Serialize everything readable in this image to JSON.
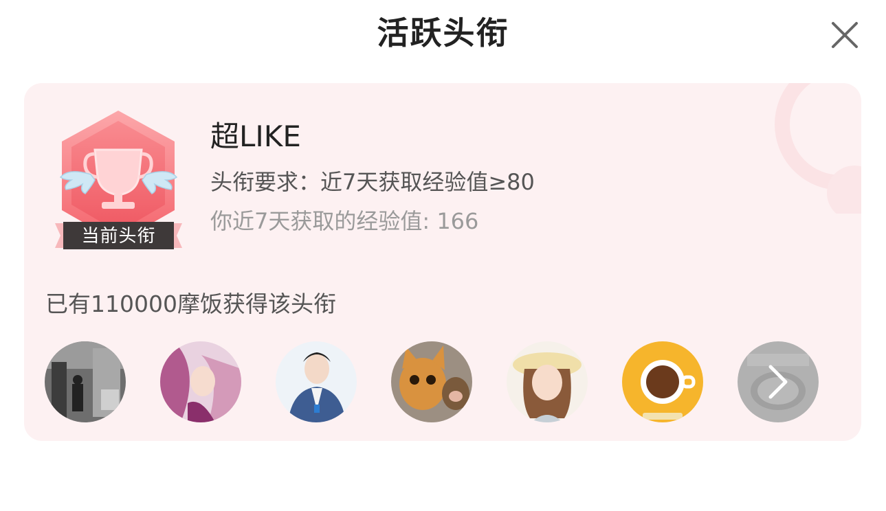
{
  "header": {
    "title": "活跃头衔"
  },
  "icons": {
    "close": "close-icon",
    "trophy": "trophy-icon",
    "more": "chevron-right-icon"
  },
  "colors": {
    "card_background": "#fdf1f2",
    "badge_red": "#f4646c",
    "title_text": "#222222",
    "secondary_text": "#555555",
    "muted_text": "#9a9a9a"
  },
  "badge": {
    "label": "当前头衔"
  },
  "title_info": {
    "name": "超LIKE",
    "requirement": "头衔要求：近7天获取经验值≥80",
    "my_exp": "你近7天获取的经验值: 166"
  },
  "owners": {
    "count_text": "已有110000摩饭获得该头衔"
  }
}
